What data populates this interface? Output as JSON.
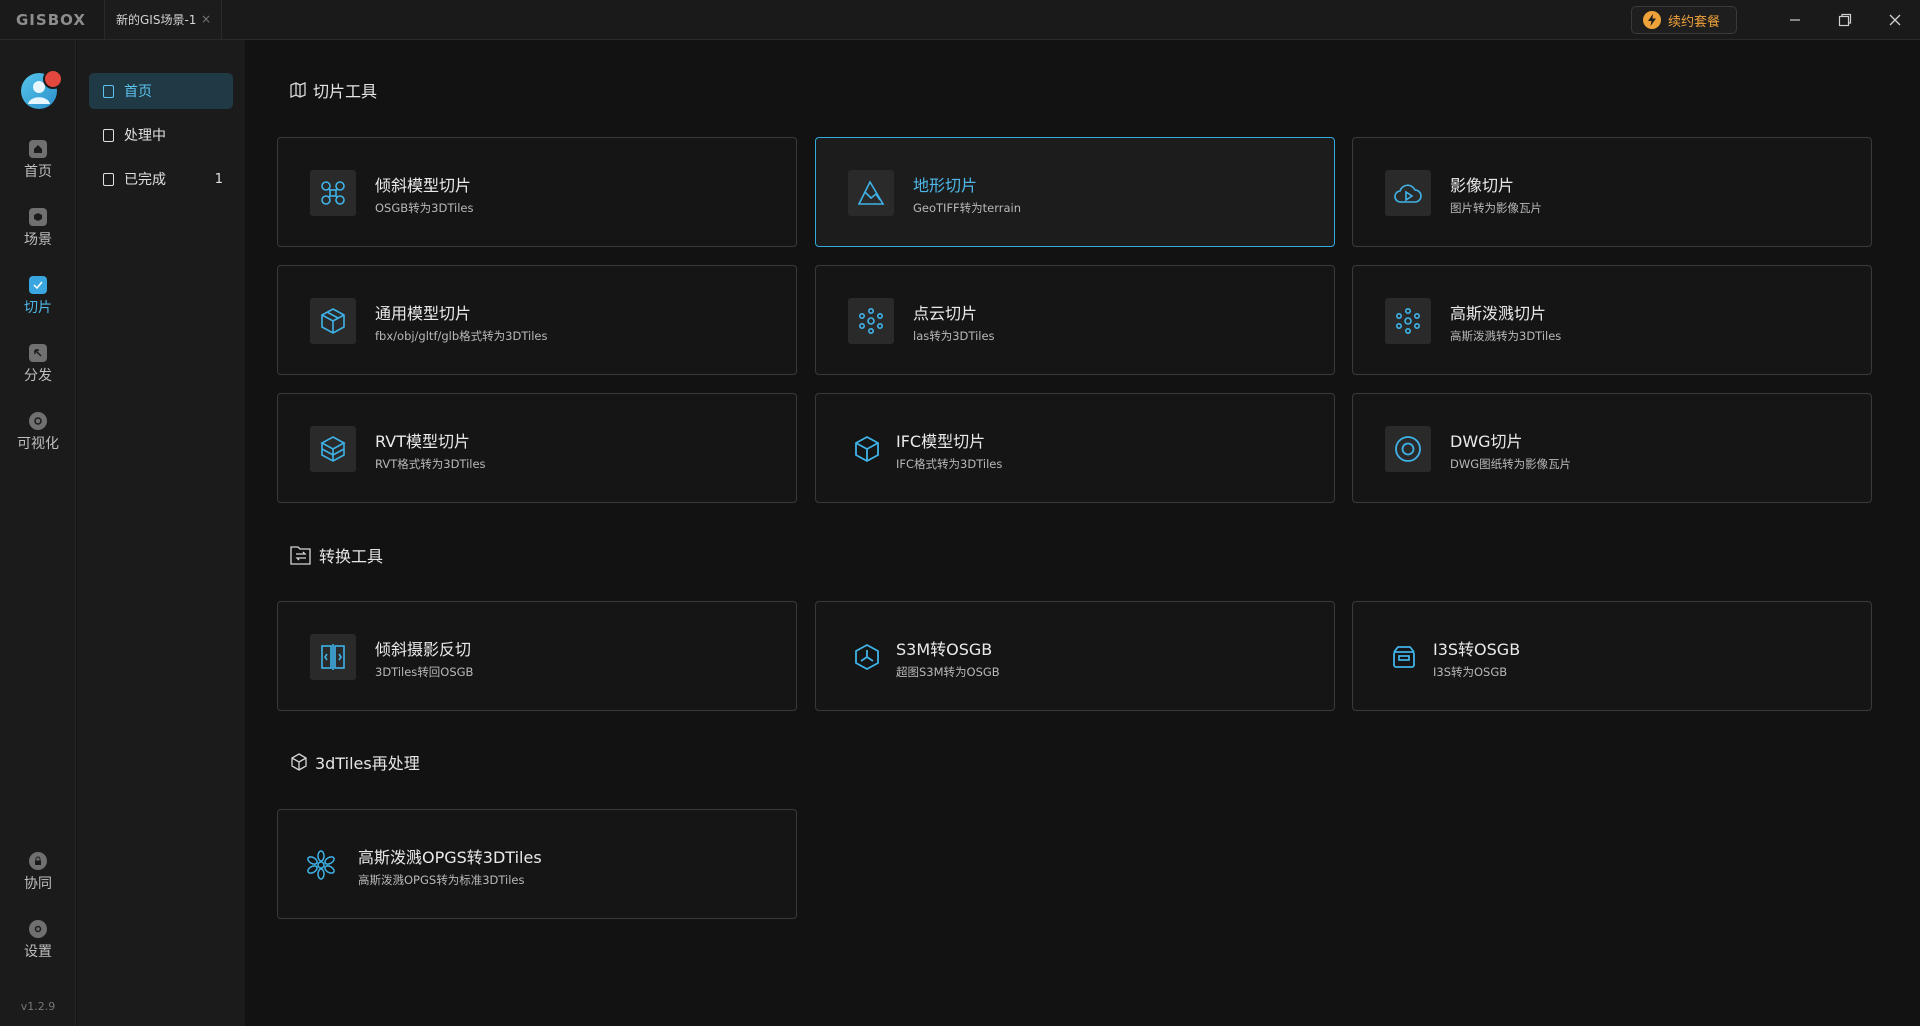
{
  "titlebar": {
    "logo": "GISBOX",
    "tab_title": "新的GIS场景-1",
    "tab_close": "×",
    "renew_label": "续约套餐"
  },
  "rail": {
    "items": [
      {
        "label": "首页",
        "icon": "home-icon"
      },
      {
        "label": "场景",
        "icon": "scene-icon"
      },
      {
        "label": "切片",
        "icon": "slice-icon",
        "active": true
      },
      {
        "label": "分发",
        "icon": "distribute-icon"
      },
      {
        "label": "可视化",
        "icon": "visualize-icon"
      },
      {
        "label": "协同",
        "icon": "lock-icon"
      },
      {
        "label": "设置",
        "icon": "settings-icon"
      }
    ],
    "version": "v1.2.9"
  },
  "subnav": {
    "items": [
      {
        "label": "首页",
        "active": true
      },
      {
        "label": "处理中"
      },
      {
        "label": "已完成",
        "count": "1"
      }
    ]
  },
  "sections": {
    "slice_tools": {
      "title": "切片工具",
      "cards": [
        {
          "name": "倾斜模型切片",
          "desc": "OSGB转为3DTiles",
          "icon": "drone-icon"
        },
        {
          "name": "地形切片",
          "desc": "GeoTIFF转为terrain",
          "icon": "mountain-icon",
          "selected": true
        },
        {
          "name": "影像切片",
          "desc": "图片转为影像瓦片",
          "icon": "cloud-play-icon"
        },
        {
          "name": "通用模型切片",
          "desc": "fbx/obj/gltf/glb格式转为3DTiles",
          "icon": "box-icon"
        },
        {
          "name": "点云切片",
          "desc": "las转为3DTiles",
          "icon": "point-cloud-icon"
        },
        {
          "name": "高斯泼溅切片",
          "desc": "高斯泼溅转为3DTiles",
          "icon": "gaussian-icon"
        },
        {
          "name": "RVT模型切片",
          "desc": "RVT格式转为3DTiles",
          "icon": "cube-stack-icon"
        },
        {
          "name": "IFC模型切片",
          "desc": "IFC格式转为3DTiles",
          "icon": "cube-outline-icon"
        },
        {
          "name": "DWG切片",
          "desc": "DWG图纸转为影像瓦片",
          "icon": "circle-target-icon"
        }
      ]
    },
    "convert_tools": {
      "title": "转换工具",
      "cards": [
        {
          "name": "倾斜摄影反切",
          "desc": "3DTiles转回OSGB",
          "icon": "code-split-icon"
        },
        {
          "name": "S3M转OSGB",
          "desc": "超图S3M转为OSGB",
          "icon": "hex-node-icon"
        },
        {
          "name": "I3S转OSGB",
          "desc": "I3S转为OSGB",
          "icon": "box-open-icon"
        }
      ]
    },
    "tiles_reprocess": {
      "title": "3dTiles再处理",
      "cards": [
        {
          "name": "高斯泼溅OPGS转3DTiles",
          "desc": "高斯泼溅OPGS转为标准3DTiles",
          "icon": "flower-icon"
        }
      ]
    }
  },
  "colors": {
    "accent": "#35a9dd",
    "warning": "#f0a23a",
    "background": "#121212",
    "card_border": "#3a3a3a"
  }
}
